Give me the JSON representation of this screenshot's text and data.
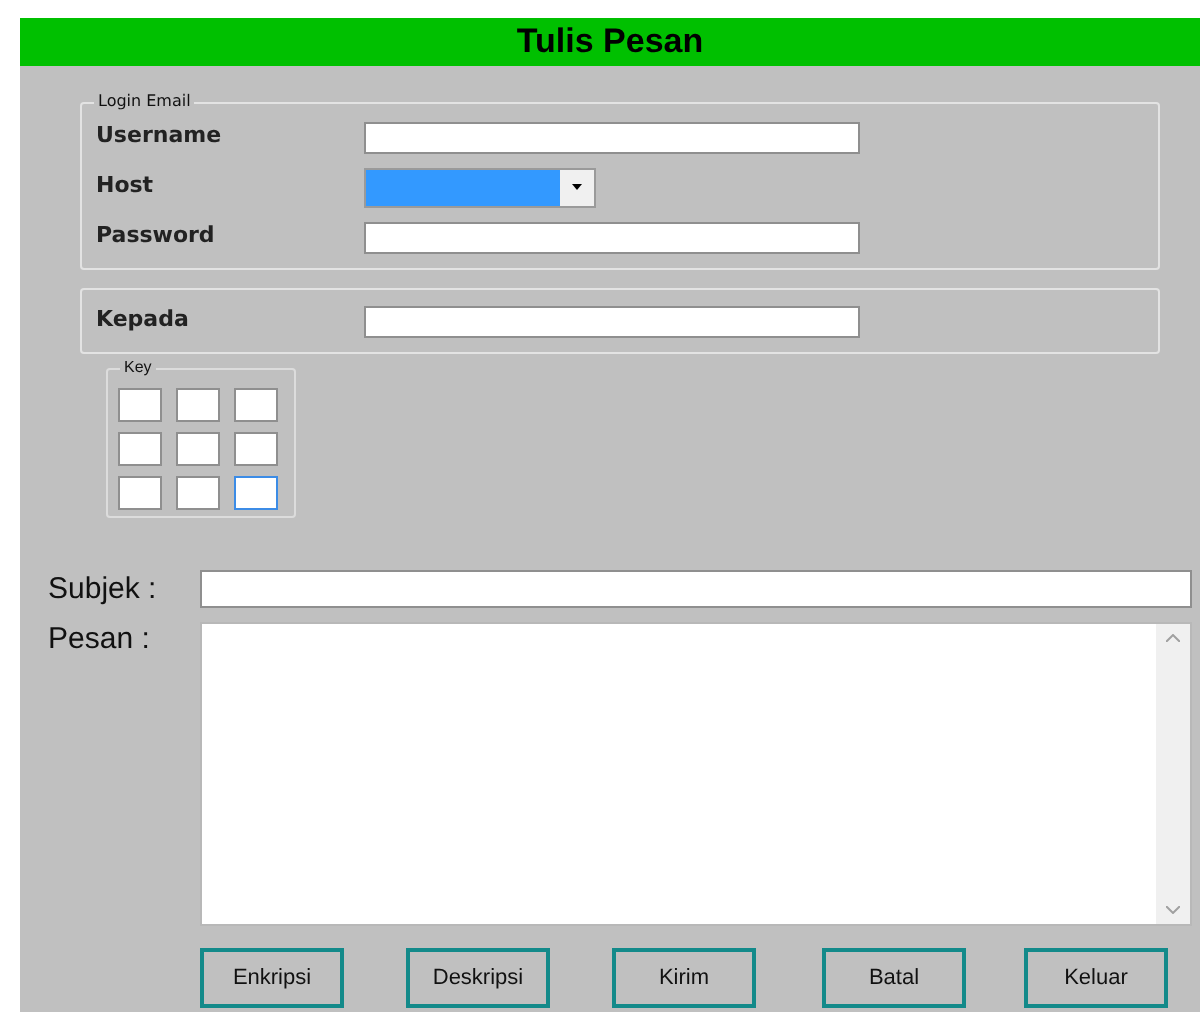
{
  "window": {
    "title": "Tulis Pesan"
  },
  "login_group": {
    "legend": "Login Email",
    "fields": [
      {
        "label": "Username",
        "kind": "text",
        "focused": false
      },
      {
        "label": "Host",
        "kind": "combo",
        "focused": true
      },
      {
        "label": "Password",
        "kind": "text",
        "focused": false
      }
    ]
  },
  "recipient_group": {
    "fields": [
      {
        "label": "Kepada",
        "kind": "text",
        "focused": false
      }
    ]
  },
  "key_group": {
    "legend": "Key",
    "cells": [
      {
        "focused": false
      },
      {
        "focused": false
      },
      {
        "focused": false
      },
      {
        "focused": false
      },
      {
        "focused": false
      },
      {
        "focused": false
      },
      {
        "focused": false
      },
      {
        "focused": false
      },
      {
        "focused": true
      }
    ]
  },
  "subject": {
    "label": "Subjek :"
  },
  "message": {
    "label": "Pesan :"
  },
  "buttons": [
    "Enkripsi",
    "Deskripsi",
    "Kirim",
    "Batal",
    "Keluar"
  ]
}
